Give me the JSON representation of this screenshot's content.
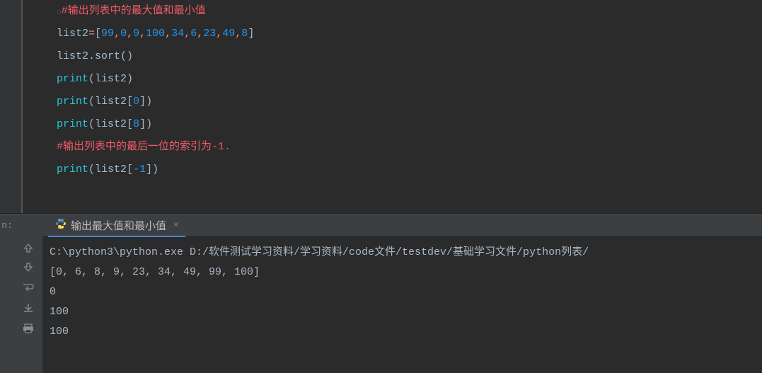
{
  "editor": {
    "lines": {
      "l1_indent": "    ",
      "l1_comment": "#输出列表中的最大值和最小值",
      "l2_a": "list2",
      "l2_eq": "=",
      "l2_open": "[",
      "l2_n1": "99",
      "l2_c1": ",",
      "l2_n2": "0",
      "l2_c2": ",",
      "l2_n3": "9",
      "l2_c3": ",",
      "l2_n4": "100",
      "l2_c4": ",",
      "l2_n5": "34",
      "l2_c5": ",",
      "l2_n6": "6",
      "l2_c6": ",",
      "l2_n7": "23",
      "l2_c7": ",",
      "l2_n8": "49",
      "l2_c8": ",",
      "l2_n9": "8",
      "l2_close": "]",
      "l3_a": "list2.sort",
      "l3_p": "()",
      "l4_f": "print",
      "l4_po": "(",
      "l4_arg": "list2",
      "l4_pc": ")",
      "l5_f": "print",
      "l5_po": "(",
      "l5_arg": "list2",
      "l5_bo": "[",
      "l5_idx": "0",
      "l5_bc": "]",
      "l5_pc": ")",
      "l6_f": "print",
      "l6_po": "(",
      "l6_arg": "list2",
      "l6_bo": "[",
      "l6_idx": "8",
      "l6_bc": "]",
      "l6_pc": ")",
      "l7_comment": "#输出列表中的最后一位的索引为-1.",
      "l8_f": "print",
      "l8_po": "(",
      "l8_arg": "list2",
      "l8_bo": "[",
      "l8_idx": "-1",
      "l8_bc": "]",
      "l8_pc": ")"
    }
  },
  "run": {
    "label": "n:",
    "tab_name": "输出最大值和最小值",
    "close_glyph": "×",
    "output": {
      "cmd": "C:\\python3\\python.exe D:/软件测试学习资料/学习资料/code文件/testdev/基础学习文件/python列表/",
      "line1": "[0, 6, 8, 9, 23, 34, 49, 99, 100]",
      "line2": "0",
      "line3": "100",
      "line4": "100"
    }
  },
  "icons": {
    "python": "python-icon",
    "up": "arrow-up-icon",
    "down": "arrow-down-icon",
    "wrap": "wrap-icon",
    "scroll_end": "scroll-to-end-icon",
    "print": "print-icon"
  }
}
